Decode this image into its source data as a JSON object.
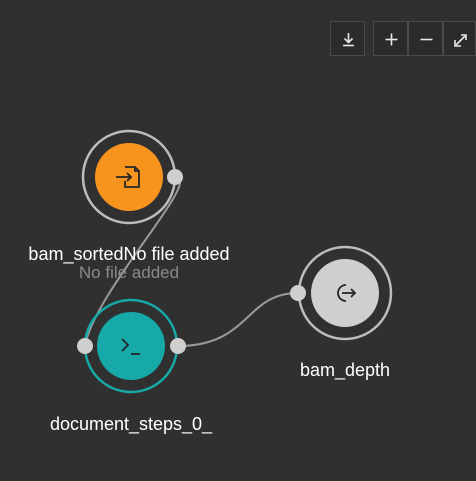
{
  "toolbar": {
    "download": "download-icon",
    "zoom_in": "plus-icon",
    "zoom_out": "minus-icon",
    "fullscreen": "expand-icon"
  },
  "nodes": [
    {
      "id": "bam_sorted",
      "label": "bam_sortedNo file added",
      "sublabel": "No file added",
      "kind": "input",
      "color": "#f7941d",
      "icon": "file-import-icon"
    },
    {
      "id": "document_steps_0_",
      "label": "document_steps_0_",
      "kind": "step",
      "color": "#17a8a8",
      "icon": "terminal-icon"
    },
    {
      "id": "bam_depth",
      "label": "bam_depth",
      "kind": "output",
      "color": "#cfcfcf",
      "icon": "output-icon"
    }
  ],
  "colors": {
    "background": "#303030",
    "edge": "#9a9a9a",
    "ring": "#bdbdbd",
    "port": "#cfcfcf"
  }
}
